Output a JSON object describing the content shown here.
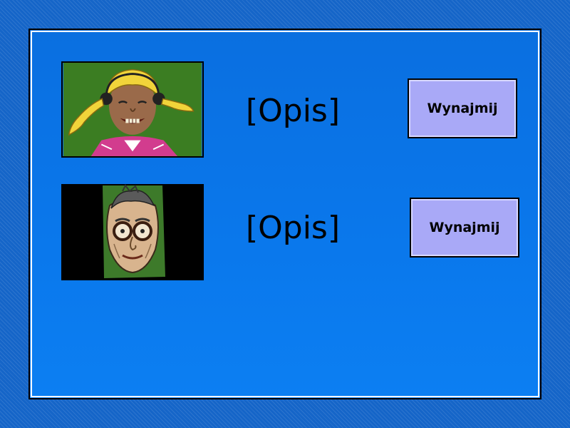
{
  "candidates": [
    {
      "portrait": "girl-with-blonde-pigtails-and-headphones-portrait",
      "description": "[Opis]",
      "rent_label": "Wynajmij"
    },
    {
      "portrait": "man-with-round-glasses-portrait",
      "description": "[Opis]",
      "rent_label": "Wynajmij"
    }
  ],
  "colors": {
    "panel_blue": "#0a78ec",
    "button_fill": "#a9a9f7",
    "portrait1_bg": "#3b7d22",
    "portrait2_bg": "#000000"
  }
}
